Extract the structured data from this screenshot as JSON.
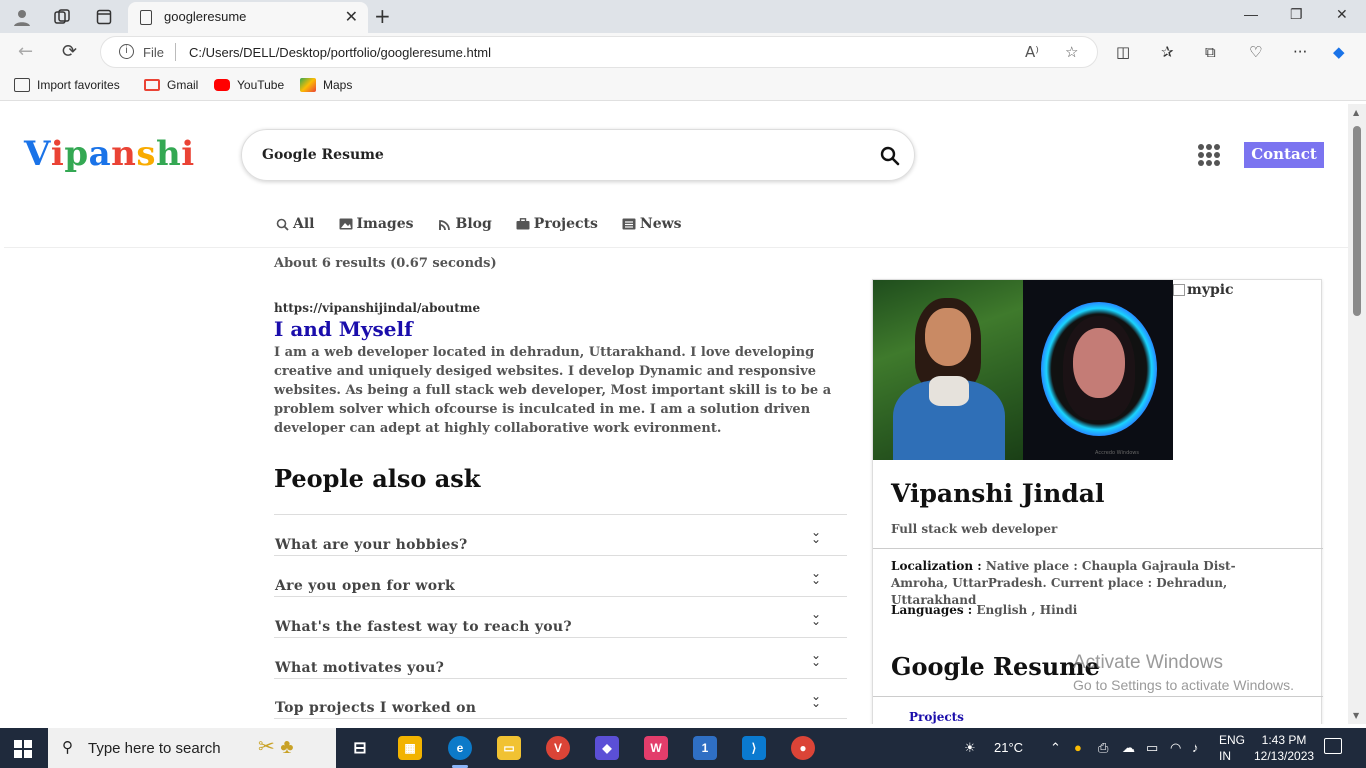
{
  "browser": {
    "tab_title": "googleresume",
    "address": {
      "scheme_label": "File",
      "path": "C:/Users/DELL/Desktop/portfolio/googleresume.html"
    },
    "favorites": [
      {
        "label": "Import favorites",
        "icon": "import-icon"
      },
      {
        "label": "Gmail",
        "icon": "gmail-icon"
      },
      {
        "label": "YouTube",
        "icon": "youtube-icon"
      },
      {
        "label": "Maps",
        "icon": "maps-icon"
      }
    ]
  },
  "page": {
    "logo": {
      "letters": [
        "V",
        "i",
        "p",
        "a",
        "n",
        "s",
        "h",
        "i"
      ],
      "colors": [
        "#1a73e8",
        "#ea4335",
        "#34a853",
        "#1a73e8",
        "#ea4335",
        "#f9ab00",
        "#34a853",
        "#ea4335"
      ]
    },
    "search_query": "Google Resume",
    "contact_label": "Contact",
    "nav_tabs": [
      {
        "label": "All",
        "icon": "search-icon"
      },
      {
        "label": "Images",
        "icon": "image-icon"
      },
      {
        "label": "Blog",
        "icon": "blog-icon"
      },
      {
        "label": "Projects",
        "icon": "briefcase-icon"
      },
      {
        "label": "News",
        "icon": "newspaper-icon"
      }
    ],
    "results_stats": "About 6 results (0.67 seconds)",
    "result": {
      "url": "https://vipanshijindal/aboutme",
      "title": "I and Myself",
      "description": "I am a web developer located in dehradun, Uttarakhand. I love developing creative and uniquely desiged websites. I develop Dynamic and responsive websites. As being a full stack web developer, Most important skill is to be a problem solver which ofcourse is inculcated in me. I am a solution driven developer can adept at highly collaborative work evironment."
    },
    "people_also_ask": {
      "title": "People also ask",
      "questions": [
        "What are your hobbies?",
        "Are you open for work",
        "What's the fastest way to reach you?",
        "What motivates you?",
        "Top projects I worked on"
      ]
    },
    "knowledge_panel": {
      "broken_image_alt": "mypic",
      "photo2_watermark": "Accredo Windows",
      "name": "Vipanshi Jindal",
      "role": "Full stack web developer",
      "localization_label": "Localization :",
      "localization_value": " Native place : Chaupla Gajraula Dist-Amroha, UttarPradesh. Current place : Dehradun, Uttarakhand",
      "languages_label": "Languages :",
      "languages_value": " English , Hindi",
      "section_title": "Google Resume",
      "first_link": "Projects"
    }
  },
  "watermark": {
    "line1": "Activate Windows",
    "line2": "Go to Settings to activate Windows."
  },
  "taskbar": {
    "search_placeholder": "Type here to search",
    "weather": "21°C",
    "language": "ENG",
    "region": "IN",
    "time": "1:43 PM",
    "date": "12/13/2023",
    "outlook_badge": "1"
  }
}
